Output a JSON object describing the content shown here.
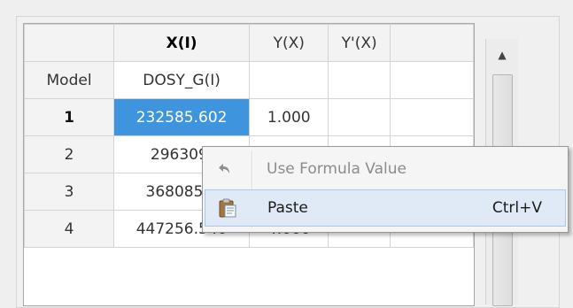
{
  "grid": {
    "columns": [
      "",
      "X(I)",
      "Y(X)",
      "Y'(X)"
    ],
    "model_row": {
      "label": "Model",
      "x": "DOSY_G(I)",
      "y": "",
      "yp": ""
    },
    "rows": [
      {
        "num": "1",
        "x": "232585.602",
        "y": "1.000",
        "yp": ""
      },
      {
        "num": "2",
        "x": "296309.",
        "y": "",
        "yp": ""
      },
      {
        "num": "3",
        "x": "368085.1",
        "y": "",
        "yp": ""
      },
      {
        "num": "4",
        "x": "447256.540",
        "y": "4.000",
        "yp": ""
      }
    ]
  },
  "context_menu": {
    "items": [
      {
        "label": "Use Formula Value",
        "shortcut": "",
        "icon": "undo-arrow-icon",
        "enabled": false
      },
      {
        "label": "Paste",
        "shortcut": "Ctrl+V",
        "icon": "clipboard-paste-icon",
        "enabled": true
      }
    ]
  },
  "scrollbar": {
    "up_icon": "scroll-up-arrow-icon"
  }
}
